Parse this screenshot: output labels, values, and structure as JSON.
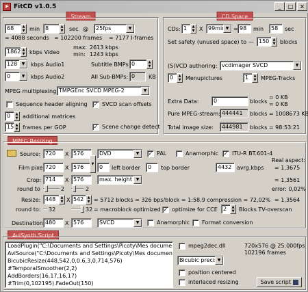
{
  "title": "FitCD v1.0.5",
  "app_icon": "FitCD",
  "title_buttons": [
    "_",
    "□",
    "×"
  ],
  "stream": {
    "group": "Stream",
    "min_val": "68",
    "min_lbl": "min",
    "sec_val": "8",
    "sec_lbl": "sec",
    "at": "@",
    "fps": "25fps",
    "seconds_text": "= 4088 seconds",
    "frames_text": "= 102200 frames",
    "iframes_text": "= 7177 I-frames",
    "video_kbps": "1862",
    "video_lbl": "kbps Video",
    "max_text": "max:",
    "max_val": "2613 kbps",
    "min2_text": "min:",
    "min2_val": "1243 kbps",
    "audio1_val": "128",
    "audio1_lbl": "kbps Audio1",
    "sub_bmps_lbl": "Subtitle BMPs:",
    "sub_bmps_val": "0",
    "audio2_val": "0",
    "audio2_lbl": "kbps Audio2",
    "all_sub_lbl": "All Sub-BMPs:",
    "all_sub_val": "0",
    "kb_lbl": "KB",
    "mux_lbl": "MPEG multiplexing:",
    "mux_val": "TMPGEnc SVCD MPEG-2",
    "seq_header": "Sequence header aligning",
    "svcd_scan": "SVCD scan offsets",
    "matrices_val": "0",
    "matrices_lbl": "additional matrices",
    "gop_val": "15",
    "gop_lbl": "frames per GOP",
    "scene_change": "Scene change detect",
    "check_mark": "✓"
  },
  "cd_space": {
    "group": "CD Space",
    "cds_lbl": "CDs:",
    "cds_val": "1",
    "x": "X",
    "size_val": "99min",
    "min_val": "98",
    "min_lbl": "min",
    "sec_val": "58",
    "sec_lbl": "sec",
    "safety_lbl": "Set safety (unused space) to",
    "safety_arrow": "—",
    "safety_val": "150",
    "blocks_lbl": "blocks",
    "authoring_lbl": "(S)VCD authoring:",
    "authoring_val": "vcdimager SVCD",
    "menupics_val": "0",
    "menupics_lbl": "Menupictures",
    "tracks_val": "1",
    "tracks_lbl": "MPEG-Tracks",
    "extra_lbl": "Extra Data:",
    "extra_val": "0",
    "extra_blocks": "blocks",
    "extra_kb1": "= 0 KB",
    "extra_kb2": "= 0 KB",
    "pure_lbl": "Pure MPEG-stream:",
    "pure_val": "444441",
    "pure_res": "blocks = 1008673 KB",
    "total_lbl": "Total image size:",
    "total_val": "444981",
    "total_res": "blocks = 98:53:21"
  },
  "resize": {
    "group": "MPEG Resizing",
    "source_lbl": "Source:",
    "source_w": "720",
    "source_h": "576",
    "source_fmt": "DVD",
    "pal": "PAL",
    "anamorphic": "Anamorphic",
    "itu": "ITU-R BT.601-4",
    "real_aspect": "Real aspect:",
    "film_lbl": "Film pixel:",
    "film_w": "720",
    "film_h": "576",
    "lb_val": "0",
    "lb_lbl": "left border",
    "tb_val": "0",
    "tb_lbl": "top border",
    "avrg_val": "4432",
    "avrg_lbl": "avrg.kbps",
    "aspect1": "= 1,3675",
    "crop_lbl": "Crop:",
    "crop_w": "714",
    "crop_h": "576",
    "crop_mode": "max. height",
    "aspect2": "= 1,3561",
    "round_lbl": "round to",
    "round_v1": "2",
    "round_v2": "2",
    "error_lbl": "error: 0,02%",
    "resize_lbl": "Resize:",
    "resize_w": "448",
    "resize_h": "542",
    "resize_calc": "= 5712 blocks = 326 bps/block = 1:58,9 compression = 72,02%",
    "aspect3": "= 1,3564",
    "round2_lbl": "round to:",
    "round2_v1": "32",
    "round2_v2": "32",
    "macroblock": "= macroblock optimized",
    "opt_cce": "optimize for CCE",
    "tv_val": "2",
    "tv_lbl": "Blocks TV-overscan",
    "dest_lbl": "Destination:",
    "dest_w": "480",
    "dest_h": "576",
    "dest_fmt": "SVCD",
    "dest_ana": "Anamorphic",
    "format_conv": "Format conversion"
  },
  "avisynth": {
    "group": "AviSynth Script",
    "lines": [
      "LoadPlugin(\"C:\\Documents and Settings\\Picoty\\Mes document",
      "AviSource(\"C:\\Documents and Settings\\Picoty\\Mes documents",
      "BicubicResize(448,542,0,0.6,3,0,714,576)",
      "#TemporalSmoother(2,2)",
      "AddBorders(16,17,16,17)",
      "#Trim(0,102195).FadeOut(150)"
    ],
    "mpeg2dec": "mpeg2dec.dll",
    "bicubic": "Bicubic precise",
    "position": "position centered",
    "interlaced": "interlaced resizing",
    "info1": "720x576 @ 25.000fps",
    "info2": "102196 frames",
    "save": "Save script"
  }
}
